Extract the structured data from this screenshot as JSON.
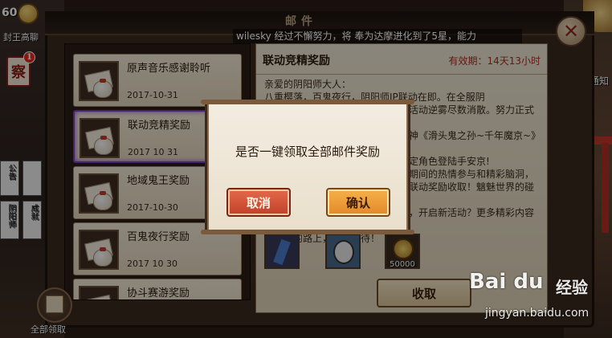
{
  "hud": {
    "level": "60",
    "player_name": "封王高聊",
    "mail_badge_char": "察",
    "mail_badge_count": "1",
    "right_label": "通知"
  },
  "side": {
    "label1": "公告",
    "label2": "阴阳师",
    "label3": "成就"
  },
  "mail_window": {
    "title": "邮件",
    "marquee": "wilesky 经过不懈努力，将 奉为达摩进化到了5星，能力",
    "close_glyph": "✕"
  },
  "mail_list": [
    {
      "name": "原声音乐感谢聆听",
      "date": "2017-10-31"
    },
    {
      "name": "联动竞精奖励",
      "date": "2017 10 31"
    },
    {
      "name": "地域鬼王奖励",
      "date": "2017-10-30"
    },
    {
      "name": "百鬼夜行奖励",
      "date": "2017 10 30"
    },
    {
      "name": "协斗赛游奖励",
      "date": ""
    }
  ],
  "collect_all": {
    "label": "全部领取"
  },
  "detail": {
    "title": "联动竞精奖励",
    "validity": "有效期：14天13小时",
    "body_lines": [
      "亲爱的阴阳师大人：",
      "    八重樱落，百鬼夜行，阴阳师IP联动在即。在全服阴",
      "阳师大人的努力下，百鬼夜行联动活动逆雾尽数消散。努力正式宣",
      "布联动开启！百鬼夜行联动限定式神《滑头鬼之孙~千年魔京~》联",
      "动限定角色也将陆续登场，联动限定角色登陆手安京!",
      "感谢大家对阴阳师的支持，在活动期间的热情参与和精彩脑洞，",
      "联动活动也将持续到来，敬请期待联动奖励收取！魑魅世界的碰撞将带",
      "来怎样的奇遇？欢迎大家参与联动，开启新活动？更多精彩内容正",
      "在赶来的路上，敬请期待！"
    ],
    "reward_coin_amount": "50000",
    "claim_label": "收取"
  },
  "dialog": {
    "message": "是否一键领取全部邮件奖励",
    "cancel_label": "取消",
    "confirm_label": "确认"
  },
  "watermark": {
    "logo": "Bai du",
    "logo_cn": "经验",
    "url": "jingyan.baidu.com"
  },
  "colors": {
    "accent_red": "#c0402a",
    "accent_orange": "#e2882a",
    "validity_red": "#b02a1c",
    "selected_border": "#7a3cc0"
  },
  "icons": {
    "close": "close-icon",
    "mail": "envelope-bag-icon",
    "gift": "gift-icon"
  }
}
